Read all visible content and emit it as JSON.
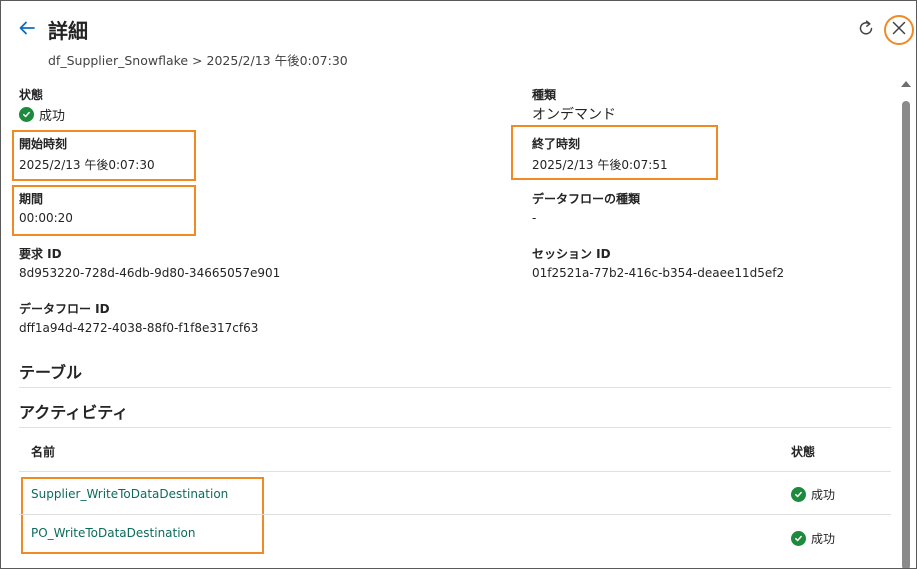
{
  "header": {
    "title": "詳細",
    "breadcrumb": "df_Supplier_Snowflake > 2025/2/13 午後0:07:30"
  },
  "details": {
    "status_label": "状態",
    "status_value": "成功",
    "type_label": "種類",
    "type_value": "オンデマンド",
    "start_label": "開始時刻",
    "start_value": "2025/2/13 午後0:07:30",
    "end_label": "終了時刻",
    "end_value": "2025/2/13 午後0:07:51",
    "duration_label": "期間",
    "duration_value": "00:00:20",
    "dataflow_type_label": "データフローの種類",
    "dataflow_type_value": "-",
    "request_id_label": "要求 ID",
    "request_id_value": "8d953220-728d-46db-9d80-34665057e901",
    "session_id_label": "セッション ID",
    "session_id_value": "01f2521a-77b2-416c-b354-deaee11d5ef2",
    "dataflow_id_label": "データフロー ID",
    "dataflow_id_value": "dff1a94d-4272-4038-88f0-f1f8e317cf63"
  },
  "sections": {
    "tables": "テーブル",
    "activities": "アクティビティ"
  },
  "activities": {
    "col_name": "名前",
    "col_status": "状態",
    "rows": [
      {
        "name": "Supplier_WriteToDataDestination",
        "status": "成功"
      },
      {
        "name": "PO_WriteToDataDestination",
        "status": "成功"
      }
    ]
  },
  "colors": {
    "highlight": "#f08a24",
    "success": "#1e8a3e",
    "link": "#0e6b5c",
    "accent": "#0f6cbd"
  }
}
